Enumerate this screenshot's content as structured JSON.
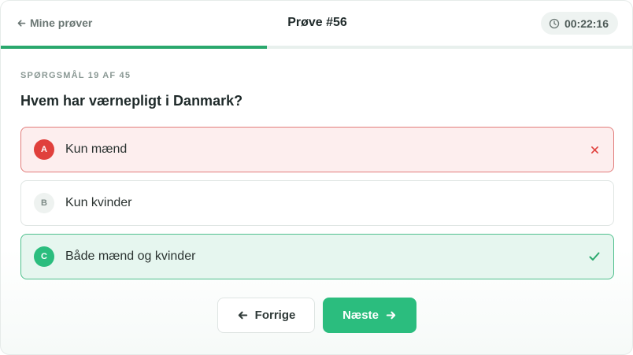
{
  "header": {
    "back_label": "Mine prøver",
    "title": "Prøve #56",
    "timer": "00:22:16"
  },
  "progress": {
    "current": 19,
    "total": 45,
    "fraction": 0.42
  },
  "question": {
    "counter": "SPØRGSMÅL 19 AF 45",
    "text": "Hvem har værnepligt i Danmark?"
  },
  "options": [
    {
      "letter": "A",
      "text": "Kun mænd",
      "state": "wrong",
      "mark_icon": "close-icon"
    },
    {
      "letter": "B",
      "text": "Kun kvinder",
      "state": "neutral",
      "mark_icon": ""
    },
    {
      "letter": "C",
      "text": "Både mænd og kvinder",
      "state": "correct",
      "mark_icon": "check-icon"
    }
  ],
  "nav": {
    "prev_label": "Forrige",
    "next_label": "Næste"
  },
  "colors": {
    "accent": "#2bbd7e",
    "progress": "#2aa86d",
    "wrong": "#e0403c",
    "wrong_bg": "#fdeeee",
    "correct_bg": "#e6f6ef"
  }
}
